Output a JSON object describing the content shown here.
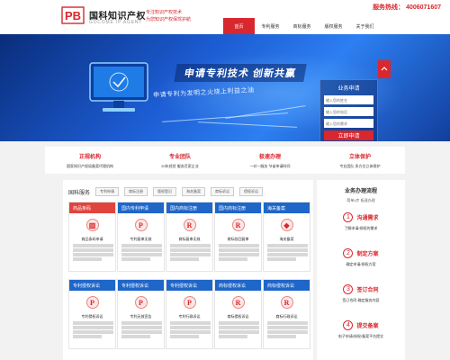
{
  "header": {
    "logo_text": "PB",
    "brand_name": "国科知识产权",
    "brand_sub": "GOCOME IP AGENT",
    "slogan_line1": "专注知识产权技术",
    "slogan_line2": "为您知识产权保驾护航",
    "hotline_label": "服务热线：",
    "hotline_number": "4006071607"
  },
  "nav": {
    "items": [
      {
        "label": "首页"
      },
      {
        "label": "专利服务"
      },
      {
        "label": "商标服务"
      },
      {
        "label": "版权服务"
      },
      {
        "label": "关于我们"
      }
    ],
    "active_index": 0
  },
  "banner": {
    "headline": "申请专利技术  创新共赢",
    "sub": "申请专利为发明之火烧上利益之油"
  },
  "apply_form": {
    "title": "业务申请",
    "field1_placeholder": "输入您的姓名",
    "field2_placeholder": "输入您的电话",
    "field3_placeholder": "输入您的需求",
    "submit_label": "立即申请"
  },
  "features": [
    {
      "title": "正规机构",
      "desc": "国家知识产权局备案代理机构"
    },
    {
      "title": "专业团队",
      "desc": "20年经验 服务百家企业"
    },
    {
      "title": "极速办理",
      "desc": "一对一服务 节省申请时间"
    },
    {
      "title": "立体保护",
      "desc": "专业团队 多方位立体保护"
    }
  ],
  "services": {
    "title": "国科服务",
    "tabs": [
      "专利申请",
      "商标注册",
      "版权登记",
      "海关备案",
      "商标诉讼",
      "侵权诉讼"
    ],
    "cards": [
      {
        "head": "商品条码",
        "title": "商品条码申请"
      },
      {
        "head": "国内专利申请",
        "title": "专利复审无效"
      },
      {
        "head": "国内商标注册",
        "title": "商标复审无效"
      },
      {
        "head": "国内商标注册",
        "title": "商标驳回复审"
      },
      {
        "head": "海关备案",
        "title": "海关备案"
      },
      {
        "head": "专利侵权诉讼",
        "title": "专利侵权诉讼"
      },
      {
        "head": "专利侵权诉讼",
        "title": "专利无效宣告"
      },
      {
        "head": "专利侵权诉讼",
        "title": "专利行政诉讼"
      },
      {
        "head": "商标侵权诉讼",
        "title": "商标侵权诉讼"
      },
      {
        "head": "商标侵权诉讼",
        "title": "商标行政诉讼"
      }
    ]
  },
  "process": {
    "title": "业务办理流程",
    "subtitle": "简单4步 极速办理",
    "steps": [
      {
        "num": "1",
        "label": "沟通需求",
        "desc": "了解申请/授权的需求"
      },
      {
        "num": "2",
        "label": "制定方案",
        "desc": "确定申请/授权方案"
      },
      {
        "num": "3",
        "label": "签订合同",
        "desc": "签订合同 确定服务内容"
      },
      {
        "num": "4",
        "label": "提交备案",
        "desc": "电子申请/授权/备案平台提交"
      }
    ]
  },
  "colors": {
    "brand_red": "#d9272e",
    "banner_blue": "#1c5bd1",
    "card_blue": "#1f66c9"
  }
}
